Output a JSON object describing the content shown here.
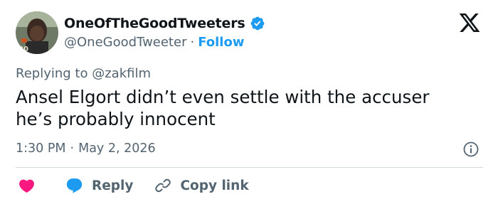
{
  "tweet": {
    "author": {
      "display_name": "OneOfTheGoodTweeters",
      "handle": "@OneGoodTweeter",
      "follow_label": "Follow",
      "verified": true,
      "avatar_icon": "profile-photo-avatar"
    },
    "separator": "·",
    "replying_to_label": "Replying to",
    "replying_to_handle": "@zakfilm",
    "text_line_1": "Ansel Elgort didn’t even settle with the accuser",
    "text_line_2": "he’s probably innocent",
    "time": "1:30 PM",
    "date": "May 2, 2026",
    "actions": {
      "like_icon": "heart-icon",
      "reply_label": "Reply",
      "copy_link_label": "Copy link"
    }
  },
  "colors": {
    "text_primary": "#0f1419",
    "text_secondary": "#536471",
    "accent_blue": "#1d9bf0",
    "like_pink": "#f91880",
    "divider": "#cfd9de"
  }
}
